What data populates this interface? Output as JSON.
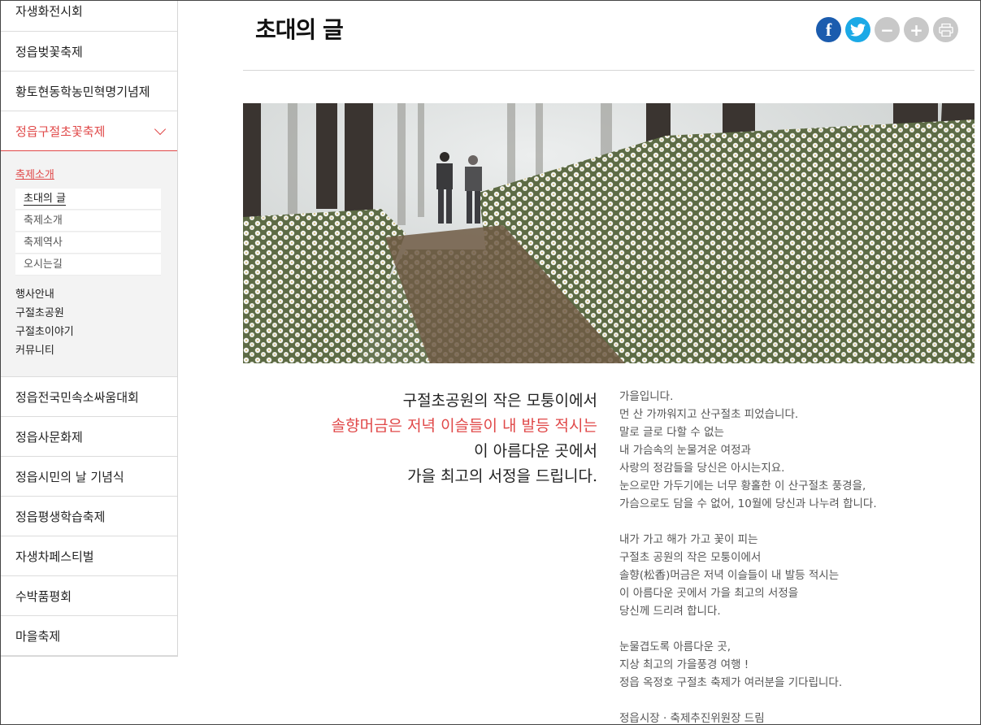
{
  "sidebar": {
    "items_top": [
      {
        "label": "자생화전시회"
      },
      {
        "label": "정읍벚꽃축제"
      },
      {
        "label": "황토현동학농민혁명기념제"
      }
    ],
    "active_item": {
      "label": "정읍구절초꽃축제"
    },
    "submenu": {
      "heading": "축제소개",
      "items": [
        {
          "label": "초대의 글"
        },
        {
          "label": "축제소개"
        },
        {
          "label": "축제역사"
        },
        {
          "label": "오시는길"
        }
      ],
      "links": [
        {
          "label": "행사안내"
        },
        {
          "label": "구절초공원"
        },
        {
          "label": "구절초이야기"
        },
        {
          "label": "커뮤니티"
        }
      ]
    },
    "items_bottom": [
      {
        "label": "정읍전국민속소싸움대회"
      },
      {
        "label": "정읍사문화제"
      },
      {
        "label": "정읍시민의 날 기념식"
      },
      {
        "label": "정읍평생학습축제"
      },
      {
        "label": "자생차페스티벌"
      },
      {
        "label": "수박품평회"
      },
      {
        "label": "마을축제"
      }
    ]
  },
  "page": {
    "title": "초대의 글"
  },
  "share": {
    "facebook_glyph": "f",
    "minus_glyph": "−",
    "plus_glyph": "+"
  },
  "quote": {
    "line1": "구절초공원의 작은 모퉁이에서",
    "line2": "솔향머금은 저녁 이슬들이 내 발등 적시는",
    "line3": "이 아름다운 곳에서",
    "line4": "가을 최고의 서정을 드립니다."
  },
  "letter": {
    "p1": [
      "가을입니다.",
      "먼 산 가까워지고 산구절초 피었습니다.",
      "말로 글로 다할 수 없는",
      "내 가슴속의 눈물겨운 여정과",
      "사랑의 정감들을 당신은 아시는지요.",
      "눈으로만 가두기에는 너무 황홀한 이 산구절초 풍경을,",
      "가슴으로도 담을 수 없어, 10월에 당신과 나누려 합니다."
    ],
    "p2": [
      "내가 가고 해가 가고 꽃이 피는",
      "구절초 공원의 작은 모퉁이에서",
      "솔향(松香)머금은 저녁 이슬들이 내 발등 적시는",
      "이 아름다운 곳에서 가을 최고의 서정을",
      "당신께 드리려 합니다."
    ],
    "p3": [
      "눈물겹도록 아름다운 곳,",
      "지상 최고의 가을풍경 여행 !",
      "정읍 옥정호 구절초 축제가 여러분을 기다립니다."
    ],
    "signature": "정읍시장 · 축제추진위원장 드림"
  },
  "colors": {
    "accent_red": "#e04848",
    "facebook": "#1b5cae",
    "twitter": "#1ba9e6",
    "icon_gray": "#c8c8c8"
  }
}
